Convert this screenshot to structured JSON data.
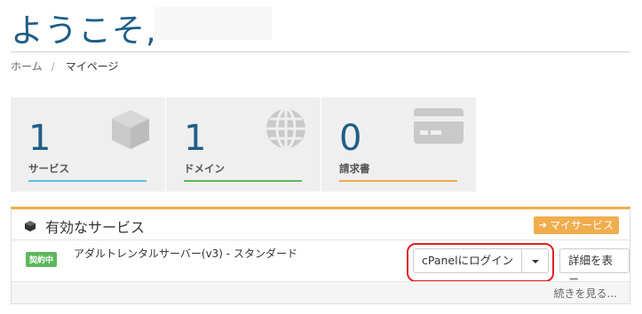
{
  "header": {
    "welcome": "ようこそ,"
  },
  "breadcrumb": {
    "home": "ホーム",
    "separator": "/",
    "current": "マイページ"
  },
  "tiles": [
    {
      "count": "1",
      "label": "サービス",
      "icon": "cube-icon",
      "color": "#5bc0de"
    },
    {
      "count": "1",
      "label": "ドメイン",
      "icon": "globe-icon",
      "color": "#5cb85c"
    },
    {
      "count": "0",
      "label": "請求書",
      "icon": "credit-card-icon",
      "color": "#f0ad4e"
    }
  ],
  "panel": {
    "title": "有効なサービス",
    "my_services_button": "マイサービス",
    "accent": "#f0ad4e",
    "service": {
      "status": "契約中",
      "name": "アダルトレンタルサーバー(v3) - スタンダード",
      "login_button": "cPanelにログイン",
      "details_button": "詳細を表示"
    },
    "footer_link": "続きを見る..."
  },
  "colors": {
    "brand": "#1f5e86",
    "highlight": "#e02020"
  }
}
